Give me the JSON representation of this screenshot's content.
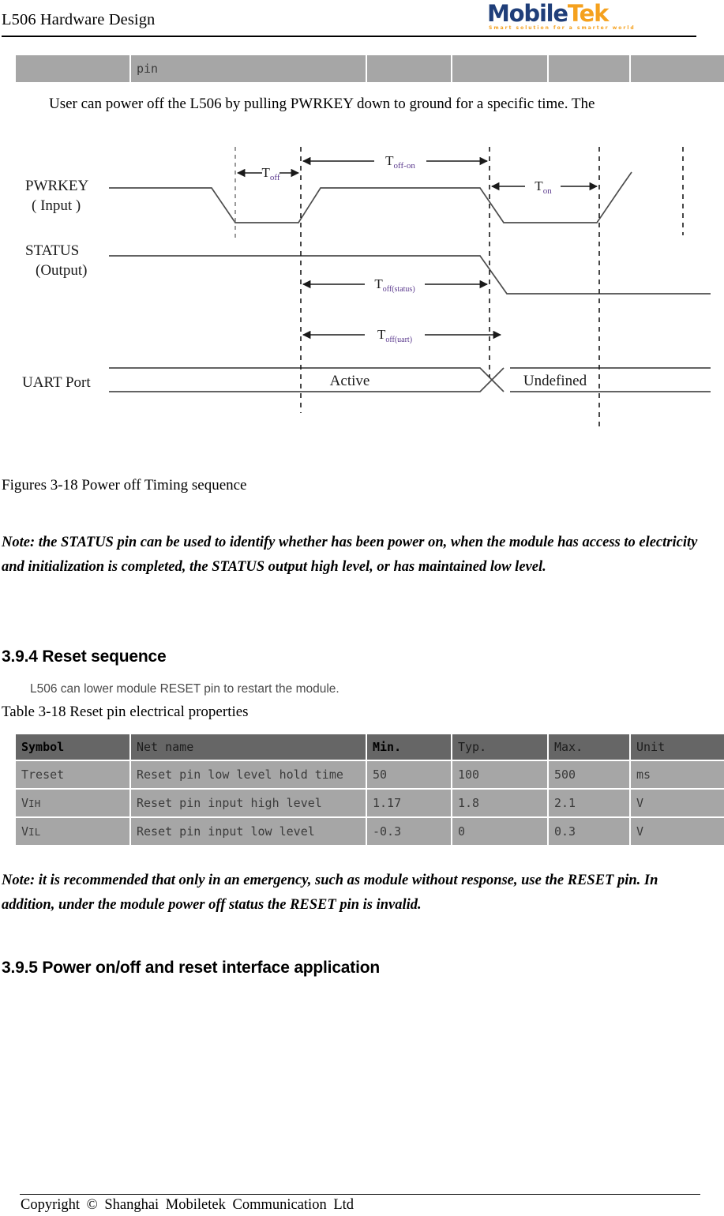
{
  "header": {
    "title": "L506 Hardware Design",
    "logo": {
      "part1": "Mobile",
      "part2": "Tek",
      "tagline": "Smart  solution  for  a  smarter  world",
      "color_primary": "#1f3e79",
      "color_accent": "#f5a11e"
    }
  },
  "top_table": {
    "columns": [
      "",
      "pin",
      "",
      "",
      "",
      ""
    ],
    "rows": [
      {
        "cells": [
          "",
          "pin",
          "",
          "",
          "",
          ""
        ]
      }
    ]
  },
  "body": {
    "paragraph_1": "User can power off the L506 by pulling PWRKEY down to ground for a specific time. The",
    "figure_caption": "Figures 3-18 Power off Timing sequence",
    "note_1": "Note: the STATUS pin can be used to identify whether has been power on, when the module has access to electricity and initialization is completed, the STATUS output high level, or has maintained low level.",
    "note_2": "Note: it is recommended that only in an emergency, such as module without response, use the RESET pin. In addition, under the module power off status the RESET pin is invalid."
  },
  "figure": {
    "signals": [
      {
        "name": "PWRKEY",
        "sub": "( Input )"
      },
      {
        "name": "STATUS",
        "sub": "(Output)"
      },
      {
        "name": "UART Port",
        "sub": ""
      }
    ],
    "timing_labels": [
      {
        "base": "T",
        "sub": "off"
      },
      {
        "base": "T",
        "sub": "off-on"
      },
      {
        "base": "T",
        "sub": "on"
      },
      {
        "base": "T",
        "sub": "off(status)"
      },
      {
        "base": "T",
        "sub": "off(uart)"
      }
    ],
    "state_labels": [
      "Active",
      "Undefined"
    ]
  },
  "section_reset": {
    "heading": "3.9.4 Reset sequence",
    "intro": "L506 can lower module RESET pin to restart the module.",
    "table_caption": "Table 3-18 Reset pin electrical properties"
  },
  "reset_table": {
    "columns": [
      "Symbol",
      "Net name",
      "Min.",
      "Typ.",
      "Max.",
      "Unit"
    ],
    "rows": [
      {
        "symbol": "Treset",
        "symbol_sub": "",
        "net_name": "Reset pin low level hold time",
        "min": "50",
        "typ": "100",
        "max": "500",
        "unit": "ms"
      },
      {
        "symbol": "V",
        "symbol_sub": "IH",
        "net_name": "Reset pin input high level",
        "min": "1.17",
        "typ": "1.8",
        "max": "2.1",
        "unit": "V"
      },
      {
        "symbol": "V",
        "symbol_sub": "IL",
        "net_name": "Reset pin input low level",
        "min": "-0.3",
        "typ": "0",
        "max": "0.3",
        "unit": "V"
      }
    ]
  },
  "section_app": {
    "heading": "3.9.5 Power on/off and reset interface application"
  },
  "footer": {
    "text": "Copyright  ©  Shanghai  Mobiletek  Communication  Ltd"
  }
}
